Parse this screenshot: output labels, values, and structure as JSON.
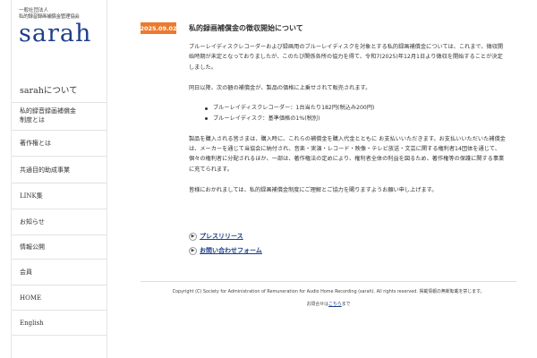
{
  "logo": {
    "line1": "一般社団法人",
    "line2": "私的録音録画補償金管理協会",
    "main": "sarah"
  },
  "sidebar": {
    "items": [
      {
        "label": "sarahについて"
      },
      {
        "label": "私的録音録画補償金制度とは"
      },
      {
        "label": "著作権とは"
      },
      {
        "label": "共通目的助成事業"
      },
      {
        "label": "LINK集"
      },
      {
        "label": "お知らせ"
      },
      {
        "label": "情報公開"
      },
      {
        "label": "会員"
      },
      {
        "label": "HOME"
      },
      {
        "label": "English"
      }
    ]
  },
  "news": {
    "date": "2025.09.02",
    "title": "私的録画補償金の徴収開始について",
    "para1": "ブルーレイディスクレコーダーおよび録画用のブルーレイディスクを対象とする私的録画補償金については、これまで、徴収開始時期が未定となっておりましたが、このたび関係各所の協力を得て、令和7(2025)年12月1日より徴収を開始することが決定しました。",
    "para2": "同日以降、次の額の補償金が、製品の価格に上乗せされて販売されます。",
    "bullets": [
      "ブルーレイディスクレコーダー：1台当たり182円(税込み200円)",
      "ブルーレイディスク：基準価格の1%(税別)"
    ],
    "para3": "製品を購入される皆さまは、購入時に、これらの補償金を購入代金とともに お支払いいただきます。お支払いいただいた補償金は、メーカーを通じて当協会に納付され、音楽・実演・レコード・映像・テレビ放送・文芸に関する権利者14団体を通じて、個々の権利者に分配されるほか、一部は、著作権法の定めにより、権利者全体の利益を図るため、著作権等の保護に関する事業に充てられます。",
    "para4": "皆様におかれましては、私的録画補償金制度にご理解とご協力を賜りますようお願い申し上げます。"
  },
  "links": {
    "press": "プレスリリース",
    "contact_form": "お問い合わせフォーム"
  },
  "footer": {
    "copyright": "Copyright (C) Society for Administration of Remuneration for Audio Home Recording (sarah). All rights reserved. 掲載情報の無断転載を禁じます。",
    "contact_prefix": "お問合せは",
    "contact_link": "こちら",
    "contact_suffix": "まで"
  }
}
